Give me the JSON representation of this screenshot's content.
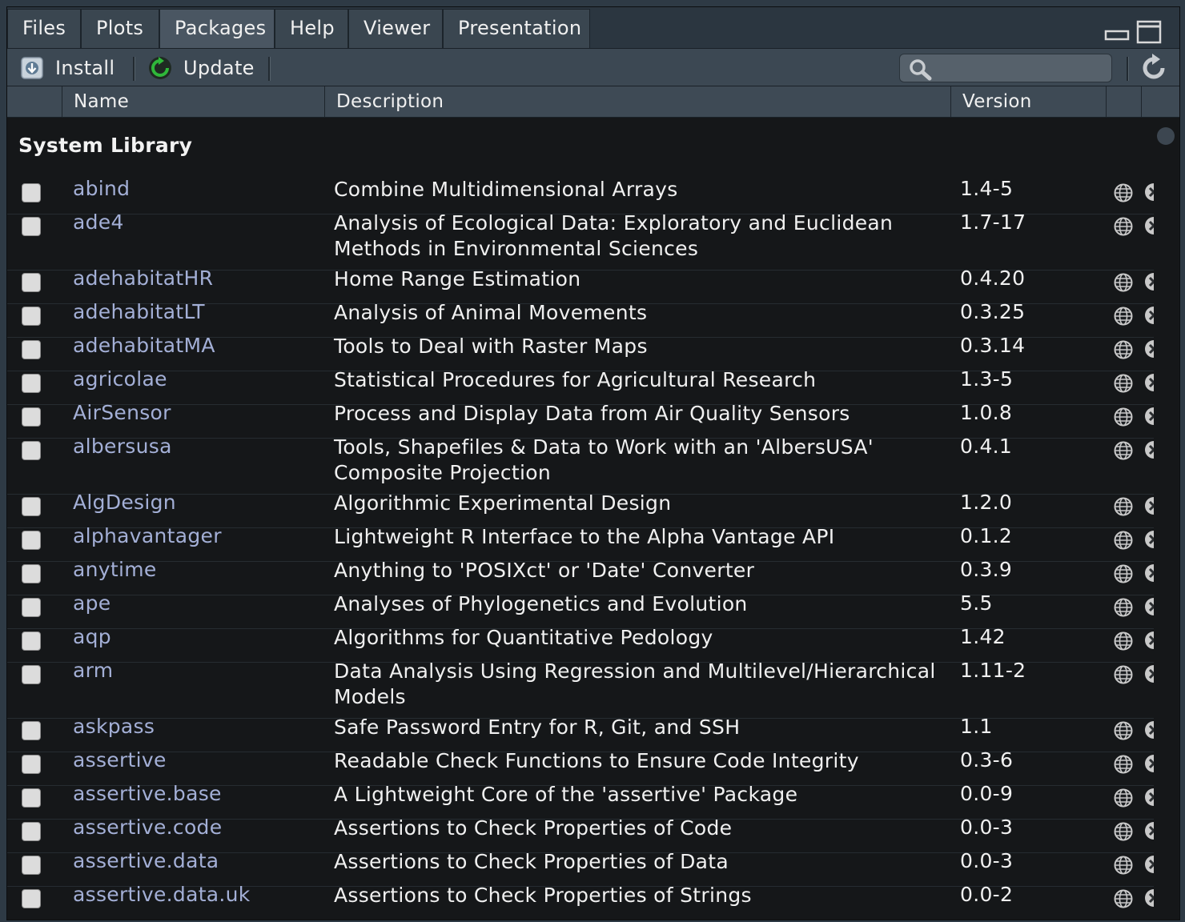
{
  "tabs": [
    {
      "label": "Files",
      "active": false
    },
    {
      "label": "Plots",
      "active": false
    },
    {
      "label": "Packages",
      "active": true
    },
    {
      "label": "Help",
      "active": false
    },
    {
      "label": "Viewer",
      "active": false
    },
    {
      "label": "Presentation",
      "active": false
    }
  ],
  "toolbar": {
    "install_label": "Install",
    "update_label": "Update",
    "search_value": "",
    "search_placeholder": ""
  },
  "columns": {
    "name": "Name",
    "description": "Description",
    "version": "Version"
  },
  "section_title": "System Library",
  "packages": [
    {
      "name": "abind",
      "description": "Combine Multidimensional Arrays",
      "version": "1.4-5"
    },
    {
      "name": "ade4",
      "description": "Analysis of Ecological Data: Exploratory and Euclidean Methods in Environmental Sciences",
      "version": "1.7-17"
    },
    {
      "name": "adehabitatHR",
      "description": "Home Range Estimation",
      "version": "0.4.20"
    },
    {
      "name": "adehabitatLT",
      "description": "Analysis of Animal Movements",
      "version": "0.3.25"
    },
    {
      "name": "adehabitatMA",
      "description": "Tools to Deal with Raster Maps",
      "version": "0.3.14"
    },
    {
      "name": "agricolae",
      "description": "Statistical Procedures for Agricultural Research",
      "version": "1.3-5"
    },
    {
      "name": "AirSensor",
      "description": "Process and Display Data from Air Quality Sensors",
      "version": "1.0.8"
    },
    {
      "name": "albersusa",
      "description": "Tools, Shapefiles & Data to Work with an 'AlbersUSA' Composite Projection",
      "version": "0.4.1"
    },
    {
      "name": "AlgDesign",
      "description": "Algorithmic Experimental Design",
      "version": "1.2.0"
    },
    {
      "name": "alphavantager",
      "description": "Lightweight R Interface to the Alpha Vantage API",
      "version": "0.1.2"
    },
    {
      "name": "anytime",
      "description": "Anything to 'POSIXct' or 'Date' Converter",
      "version": "0.3.9"
    },
    {
      "name": "ape",
      "description": "Analyses of Phylogenetics and Evolution",
      "version": "5.5"
    },
    {
      "name": "aqp",
      "description": "Algorithms for Quantitative Pedology",
      "version": "1.42"
    },
    {
      "name": "arm",
      "description": "Data Analysis Using Regression and Multilevel/Hierarchical Models",
      "version": "1.11-2"
    },
    {
      "name": "askpass",
      "description": "Safe Password Entry for R, Git, and SSH",
      "version": "1.1"
    },
    {
      "name": "assertive",
      "description": "Readable Check Functions to Ensure Code Integrity",
      "version": "0.3-6"
    },
    {
      "name": "assertive.base",
      "description": "A Lightweight Core of the 'assertive' Package",
      "version": "0.0-9"
    },
    {
      "name": "assertive.code",
      "description": "Assertions to Check Properties of Code",
      "version": "0.0-3"
    },
    {
      "name": "assertive.data",
      "description": "Assertions to Check Properties of Data",
      "version": "0.0-3"
    },
    {
      "name": "assertive.data.uk",
      "description": "Assertions to Check Properties of Strings",
      "version": "0.0-2"
    }
  ],
  "colors": {
    "package_link": "#a3afd6",
    "background": "#151719",
    "header": "#3e4a55",
    "update_icon": "#2fb83a"
  },
  "icons": {
    "install": "install-icon",
    "update": "update-icon",
    "search": "search-icon",
    "refresh": "refresh-icon",
    "website": "globe-icon",
    "uninstall": "remove-icon"
  }
}
